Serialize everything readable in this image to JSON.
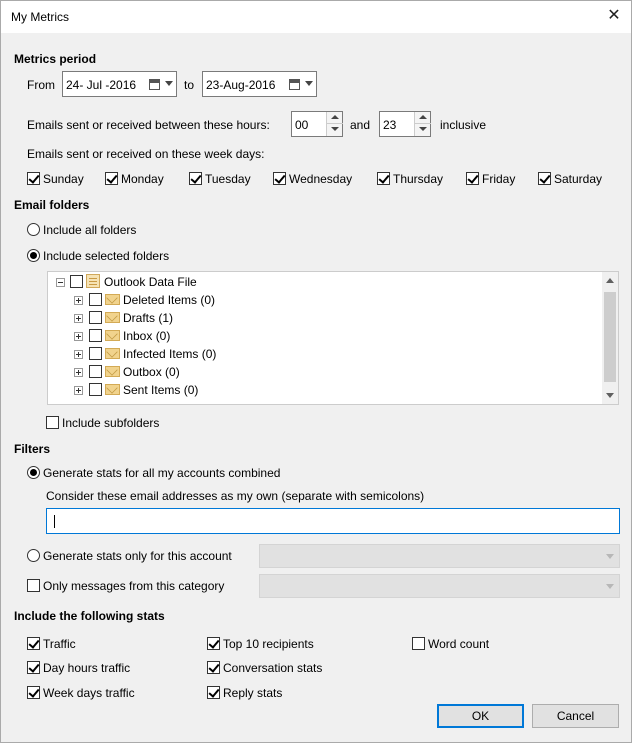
{
  "window": {
    "title": "My Metrics",
    "close_glyph": "✕"
  },
  "metrics_period": {
    "heading": "Metrics period",
    "from_label": "From",
    "from_value": "24- Jul -2016",
    "to_label": "to",
    "to_value": "23-Aug-2016",
    "hours_label": "Emails sent or received between these hours:",
    "hours_from": "00",
    "hours_and": "and",
    "hours_to": "23",
    "inclusive": "inclusive",
    "weekdays_label": "Emails sent or received on these week days:",
    "weekdays": [
      {
        "label": "Sunday",
        "checked": true
      },
      {
        "label": "Monday",
        "checked": true
      },
      {
        "label": "Tuesday",
        "checked": true
      },
      {
        "label": "Wednesday",
        "checked": true
      },
      {
        "label": "Thursday",
        "checked": true
      },
      {
        "label": "Friday",
        "checked": true
      },
      {
        "label": "Saturday",
        "checked": true
      }
    ]
  },
  "email_folders": {
    "heading": "Email folders",
    "include_all": "Include all folders",
    "include_selected": "Include selected folders",
    "selected_option": "include_selected",
    "tree": {
      "root": {
        "label": "Outlook Data File",
        "checked": false
      },
      "children": [
        {
          "label": "Deleted Items (0)",
          "checked": false
        },
        {
          "label": "Drafts (1)",
          "checked": false
        },
        {
          "label": "Inbox (0)",
          "checked": false
        },
        {
          "label": "Infected Items (0)",
          "checked": false
        },
        {
          "label": "Outbox (0)",
          "checked": false
        },
        {
          "label": "Sent Items (0)",
          "checked": false
        }
      ]
    },
    "include_subfolders": "Include subfolders",
    "include_subfolders_checked": false
  },
  "filters": {
    "heading": "Filters",
    "all_accounts": "Generate stats for all my accounts combined",
    "own_addresses_label": "Consider these email addresses as my own (separate with semicolons)",
    "own_addresses_value": "",
    "this_account": "Generate stats only for this account",
    "category": "Only messages from this category",
    "selected_option": "all_accounts"
  },
  "stats": {
    "heading": "Include the following stats",
    "items": [
      {
        "label": "Traffic",
        "checked": true
      },
      {
        "label": "Day hours traffic",
        "checked": true
      },
      {
        "label": "Week days traffic",
        "checked": true
      },
      {
        "label": "Top 10 recipients",
        "checked": true
      },
      {
        "label": "Conversation stats",
        "checked": true
      },
      {
        "label": "Reply stats",
        "checked": true
      },
      {
        "label": "Word count",
        "checked": false
      }
    ]
  },
  "buttons": {
    "ok": "OK",
    "cancel": "Cancel"
  },
  "colors": {
    "focus_border": "#0078d7",
    "background": "#f0f0f0"
  }
}
